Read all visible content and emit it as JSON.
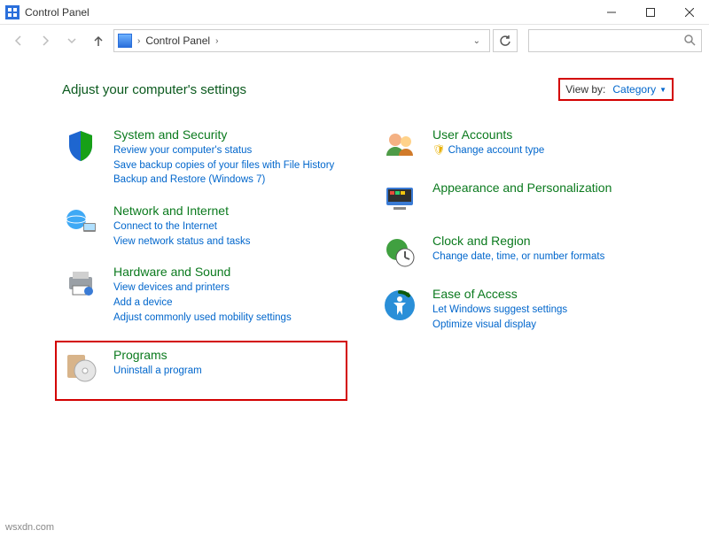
{
  "window": {
    "title": "Control Panel"
  },
  "breadcrumb": {
    "root_chev": "›",
    "item": "Control Panel",
    "tail_chev": "›"
  },
  "heading": "Adjust your computer's settings",
  "viewby": {
    "label": "View by:",
    "value": "Category"
  },
  "left": {
    "system": {
      "title": "System and Security",
      "l1": "Review your computer's status",
      "l2": "Save backup copies of your files with File History",
      "l3": "Backup and Restore (Windows 7)"
    },
    "network": {
      "title": "Network and Internet",
      "l1": "Connect to the Internet",
      "l2": "View network status and tasks"
    },
    "hardware": {
      "title": "Hardware and Sound",
      "l1": "View devices and printers",
      "l2": "Add a device",
      "l3": "Adjust commonly used mobility settings"
    },
    "programs": {
      "title": "Programs",
      "l1": "Uninstall a program"
    }
  },
  "right": {
    "users": {
      "title": "User Accounts",
      "l1": "Change account type"
    },
    "appearance": {
      "title": "Appearance and Personalization"
    },
    "clock": {
      "title": "Clock and Region",
      "l1": "Change date, time, or number formats"
    },
    "ease": {
      "title": "Ease of Access",
      "l1": "Let Windows suggest settings",
      "l2": "Optimize visual display"
    }
  },
  "watermark": "wsxdn.com"
}
